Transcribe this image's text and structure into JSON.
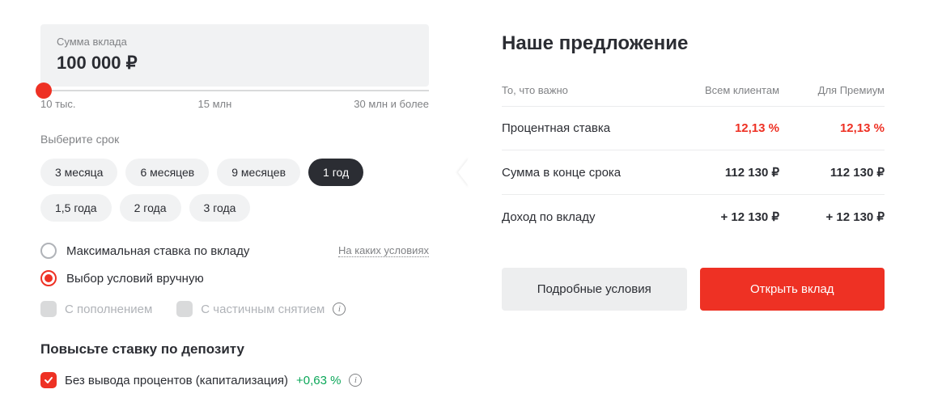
{
  "left": {
    "amount_label": "Сумма вклада",
    "amount_value": "100 000 ₽",
    "slider_min": "10 тыс.",
    "slider_mid": "15 млн",
    "slider_max": "30 млн и более",
    "term_label": "Выберите срок",
    "terms": [
      "3 месяца",
      "6 месяцев",
      "9 месяцев",
      "1 год",
      "1,5 года",
      "2 года",
      "3 года"
    ],
    "term_active_index": 3,
    "radio_max": "Максимальная ставка по вкладу",
    "radio_manual": "Выбор условий вручную",
    "conditions_link": "На каких условиях",
    "cb_topup": "С пополнением",
    "cb_partial": "С частичным снятием",
    "boost_title": "Повысьте ставку по депозиту",
    "boost_cap": "Без вывода процентов (капитализация)",
    "boost_pct": "+0,63 %"
  },
  "right": {
    "title": "Наше предложение",
    "header_note": "То, что важно",
    "header_all": "Всем клиентам",
    "header_premium": "Для Премиум",
    "rows": [
      {
        "label": "Процентная ставка",
        "all": "12,13 %",
        "premium": "12,13 %",
        "red": true
      },
      {
        "label": "Сумма в конце срока",
        "all": "112 130 ₽",
        "premium": "112 130 ₽",
        "red": false
      },
      {
        "label": "Доход по вкладу",
        "all": "+ 12 130 ₽",
        "premium": "+ 12 130 ₽",
        "red": false
      }
    ],
    "btn_details": "Подробные условия",
    "btn_open": "Открыть вклад"
  }
}
